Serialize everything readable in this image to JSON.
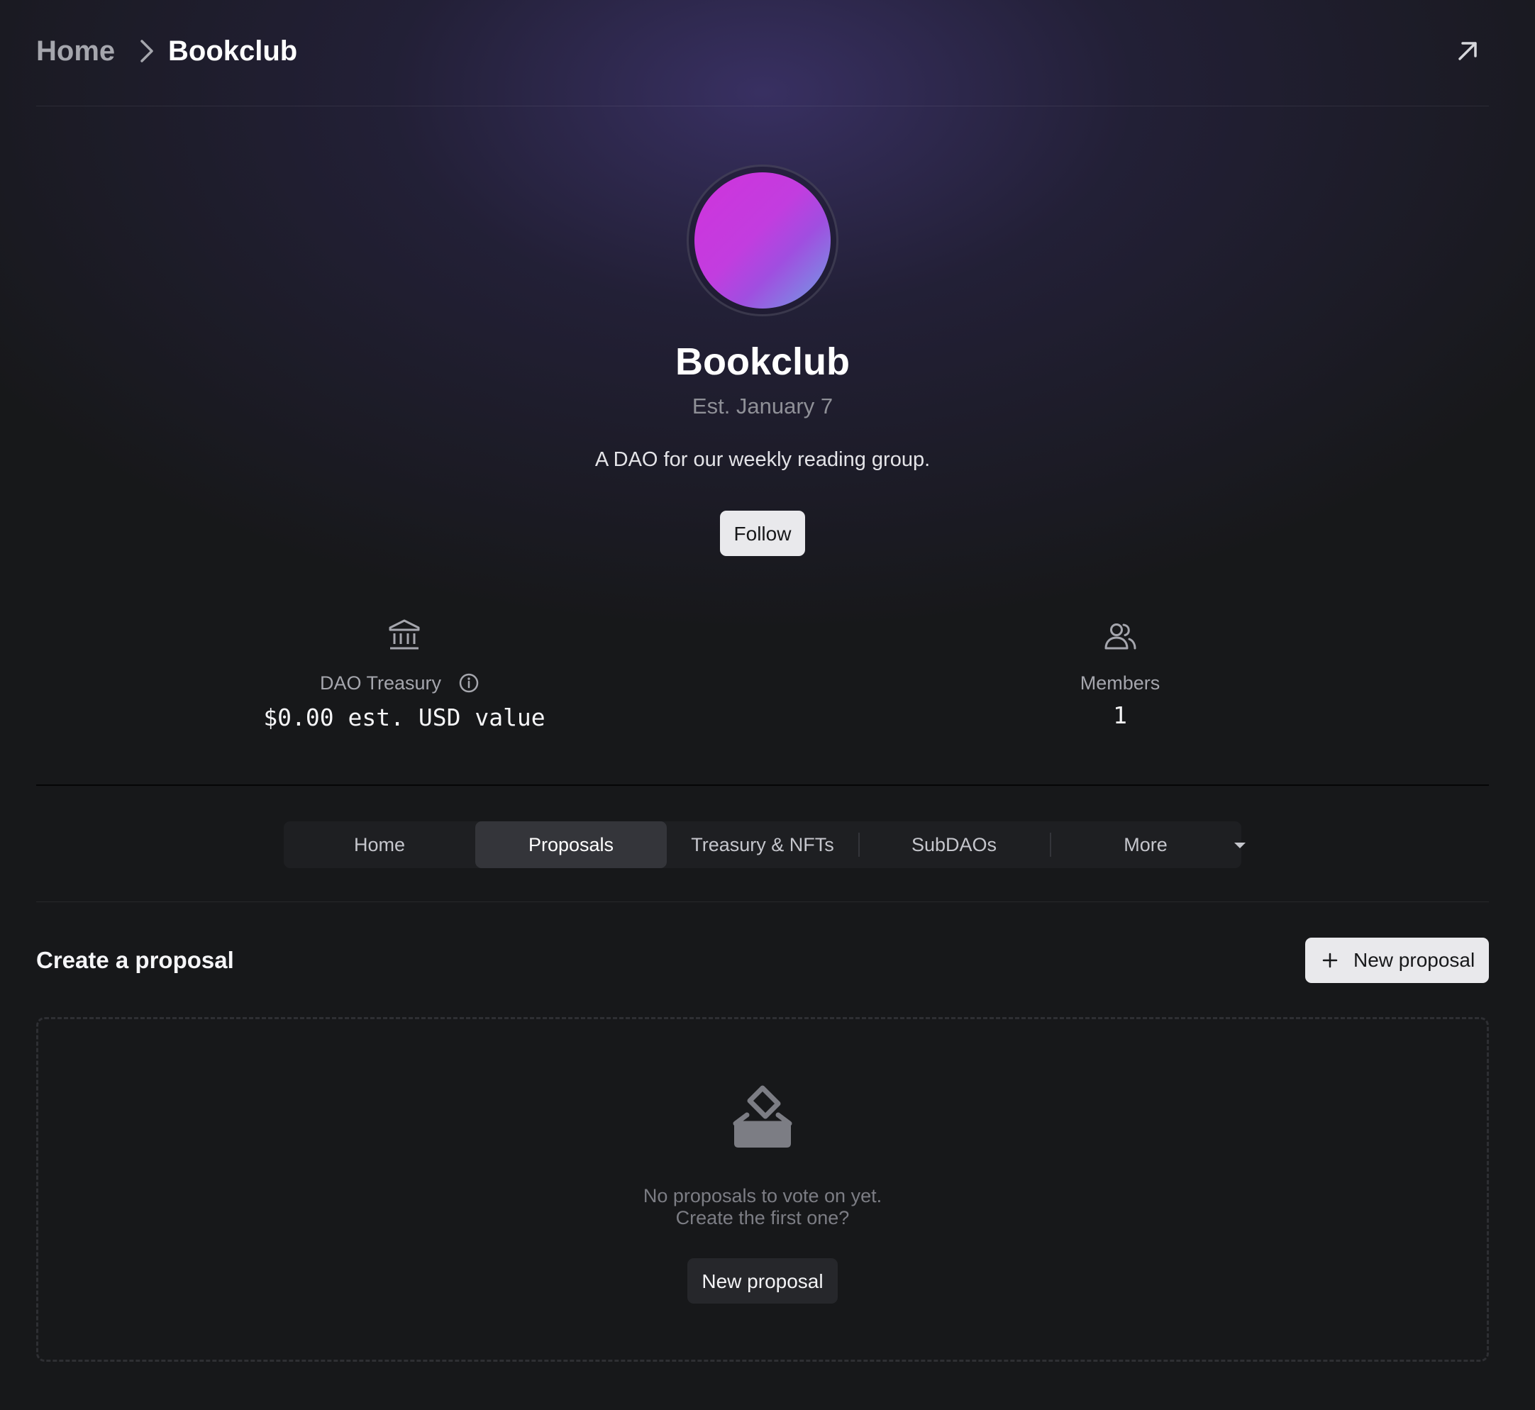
{
  "breadcrumb": {
    "home": "Home",
    "current": "Bookclub"
  },
  "dao": {
    "name": "Bookclub",
    "established": "Est. January 7",
    "description": "A DAO for our weekly reading group.",
    "follow_label": "Follow",
    "avatar_gradient": [
      "#d033dc",
      "#6ea2e4"
    ]
  },
  "stats": {
    "treasury": {
      "label": "DAO Treasury",
      "value": "$0.00 est. USD value",
      "icon": "bank-icon"
    },
    "members": {
      "label": "Members",
      "value": "1",
      "icon": "users-icon"
    }
  },
  "tabs": [
    {
      "label": "Home",
      "active": false
    },
    {
      "label": "Proposals",
      "active": true
    },
    {
      "label": "Treasury & NFTs",
      "active": false
    },
    {
      "label": "SubDAOs",
      "active": false
    },
    {
      "label": "More",
      "active": false
    }
  ],
  "proposals": {
    "title": "Create a proposal",
    "new_button": "New proposal",
    "empty_line1": "No proposals to vote on yet.",
    "empty_line2": "Create the first one?",
    "empty_button": "New proposal"
  },
  "colors": {
    "background": "#17181a",
    "button_light": "#e9e9ec",
    "tab_active": "#34353a"
  }
}
